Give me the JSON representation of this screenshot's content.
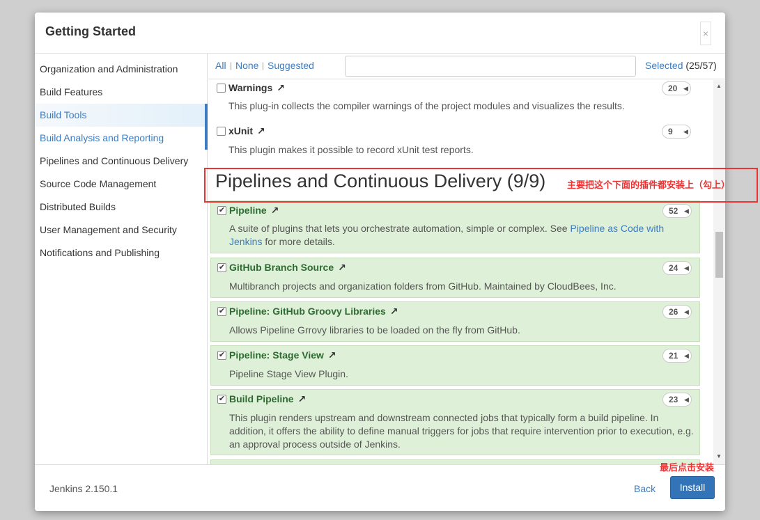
{
  "dialog": {
    "title": "Getting Started",
    "close_glyph": "×"
  },
  "sidebar": {
    "items": [
      {
        "label": "Organization and Administration",
        "state": "normal"
      },
      {
        "label": "Build Features",
        "state": "normal"
      },
      {
        "label": "Build Tools",
        "state": "active"
      },
      {
        "label": "Build Analysis and Reporting",
        "state": "link"
      },
      {
        "label": "Pipelines and Continuous Delivery",
        "state": "normal"
      },
      {
        "label": "Source Code Management",
        "state": "normal"
      },
      {
        "label": "Distributed Builds",
        "state": "normal"
      },
      {
        "label": "User Management and Security",
        "state": "normal"
      },
      {
        "label": "Notifications and Publishing",
        "state": "normal"
      }
    ]
  },
  "toolbar": {
    "all": "All",
    "sep": "|",
    "none": "None",
    "suggested": "Suggested",
    "search_value": "",
    "search_clear": "×",
    "selected_label": "Selected",
    "selected_count": "(25/57)"
  },
  "plugins_before": [
    {
      "name": "Warnings",
      "checked": false,
      "count": "20",
      "desc": "This plug-in collects the compiler warnings of the project modules and visualizes the results."
    },
    {
      "name": "xUnit",
      "checked": false,
      "count": "9",
      "desc": "This plugin makes it possible to record xUnit test reports."
    }
  ],
  "category": {
    "title": "Pipelines and Continuous Delivery (9/9)"
  },
  "plugins": [
    {
      "name": "Pipeline",
      "checked": true,
      "count": "52",
      "desc_pre": "A suite of plugins that lets you orchestrate automation, simple or complex. See ",
      "desc_link": "Pipeline as Code with Jenkins",
      "desc_post": " for more details."
    },
    {
      "name": "GitHub Branch Source",
      "checked": true,
      "count": "24",
      "desc": "Multibranch projects and organization folders from GitHub. Maintained by CloudBees, Inc."
    },
    {
      "name": "Pipeline: GitHub Groovy Libraries",
      "checked": true,
      "count": "26",
      "desc": "Allows Pipeline Grrovy libraries to be loaded on the fly from GitHub."
    },
    {
      "name": "Pipeline: Stage View",
      "checked": true,
      "count": "21",
      "desc": "Pipeline Stage View Plugin."
    },
    {
      "name": "Build Pipeline",
      "checked": true,
      "count": "23",
      "desc": "This plugin renders upstream and downstream connected jobs that typically form a build pipeline. In addition, it offers the ability to define manual triggers for jobs that require intervention prior to execution, e.g. an approval process outside of Jenkins."
    }
  ],
  "icons": {
    "external_link": "↗",
    "check": "✔",
    "badge_arrow": "◀",
    "scroll_up": "▲",
    "scroll_down": "▼"
  },
  "annotations": {
    "note1": "主要把这个下面的插件都安装上（勾上）",
    "note2": "最后点击安装",
    "color": "#e33333"
  },
  "footer": {
    "version": "Jenkins 2.150.1",
    "back": "Back",
    "install": "Install"
  }
}
